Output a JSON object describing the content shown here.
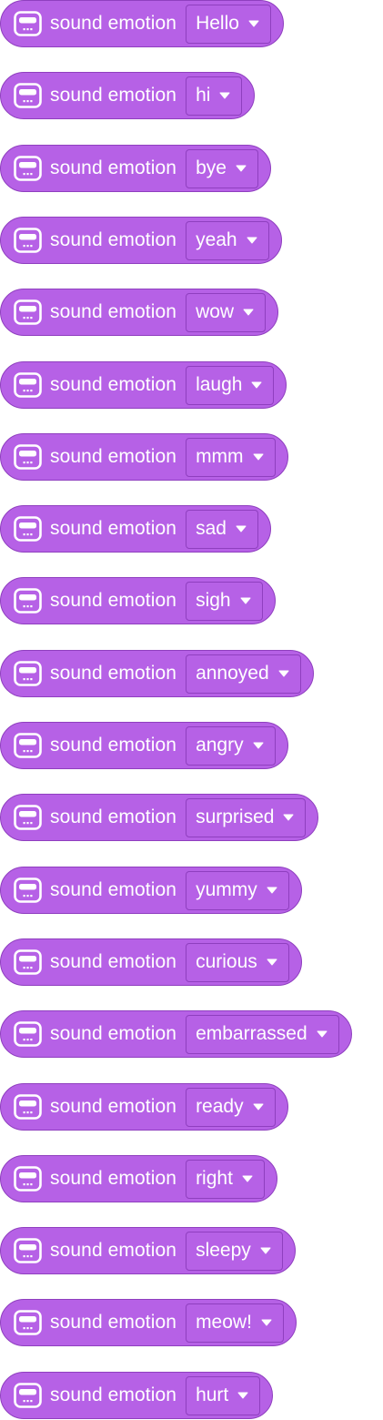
{
  "block_label": "sound emotion",
  "colors": {
    "block_fill": "#b661e6",
    "block_border": "#8f3fbf",
    "text": "#ffffff"
  },
  "icons": {
    "block": "robot-face-icon",
    "dropdown": "caret-down-icon"
  },
  "blocks": [
    {
      "label": "sound emotion",
      "value": "Hello"
    },
    {
      "label": "sound emotion",
      "value": "hi"
    },
    {
      "label": "sound emotion",
      "value": "bye"
    },
    {
      "label": "sound emotion",
      "value": "yeah"
    },
    {
      "label": "sound emotion",
      "value": "wow"
    },
    {
      "label": "sound emotion",
      "value": "laugh"
    },
    {
      "label": "sound emotion",
      "value": "mmm"
    },
    {
      "label": "sound emotion",
      "value": "sad"
    },
    {
      "label": "sound emotion",
      "value": "sigh"
    },
    {
      "label": "sound emotion",
      "value": "annoyed"
    },
    {
      "label": "sound emotion",
      "value": "angry"
    },
    {
      "label": "sound emotion",
      "value": "surprised"
    },
    {
      "label": "sound emotion",
      "value": "yummy"
    },
    {
      "label": "sound emotion",
      "value": "curious"
    },
    {
      "label": "sound emotion",
      "value": "embarrassed"
    },
    {
      "label": "sound emotion",
      "value": "ready"
    },
    {
      "label": "sound emotion",
      "value": "right"
    },
    {
      "label": "sound emotion",
      "value": "sleepy"
    },
    {
      "label": "sound emotion",
      "value": "meow!"
    },
    {
      "label": "sound emotion",
      "value": "hurt"
    }
  ]
}
